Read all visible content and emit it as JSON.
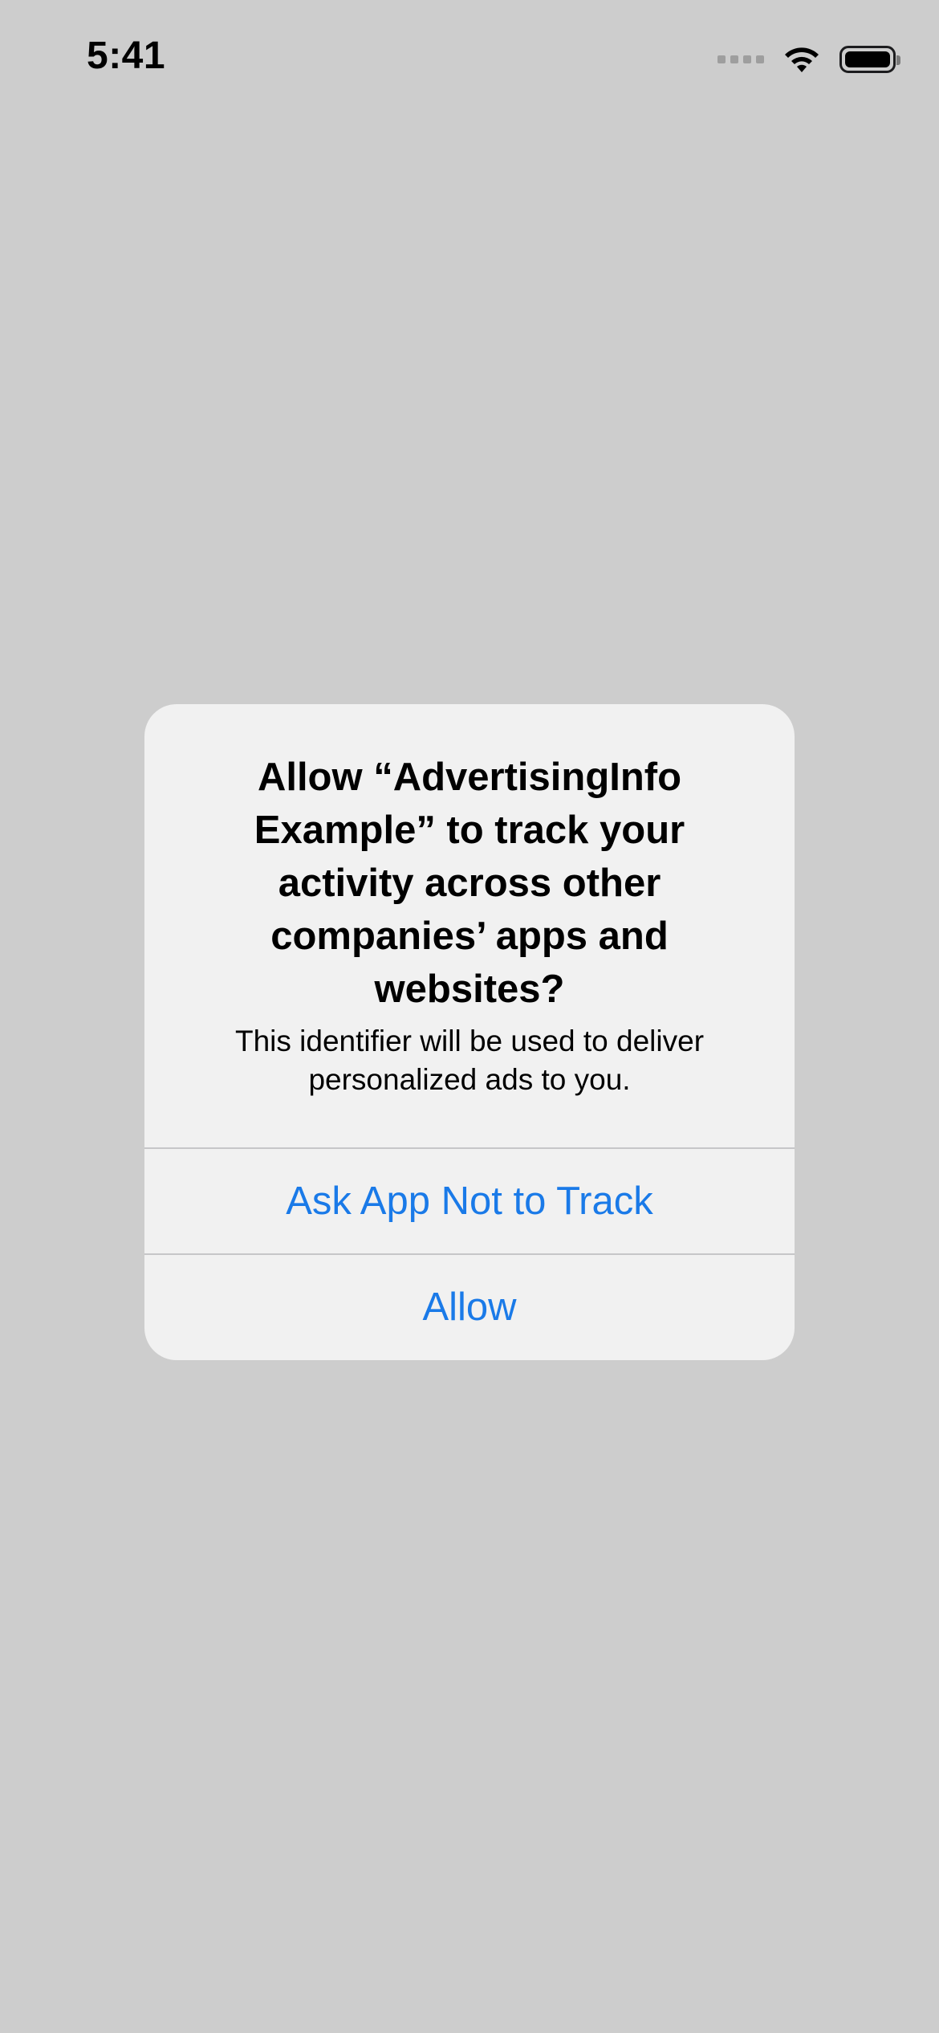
{
  "status_bar": {
    "time": "5:41",
    "signal_icon": "cellular-signal-icon",
    "wifi_icon": "wifi-icon",
    "battery_icon": "battery-icon"
  },
  "alert": {
    "title": "Allow “AdvertisingInfo Example” to track your activity across other companies’ apps and websites?",
    "message": "This identifier will be used to deliver personalized ads to you.",
    "buttons": [
      {
        "label": "Ask App Not to Track"
      },
      {
        "label": "Allow"
      }
    ]
  },
  "colors": {
    "background": "#cdcdcd",
    "alert_background": "#f1f1f1",
    "button_text": "#1a7ae8",
    "divider": "#c6c6c8"
  }
}
